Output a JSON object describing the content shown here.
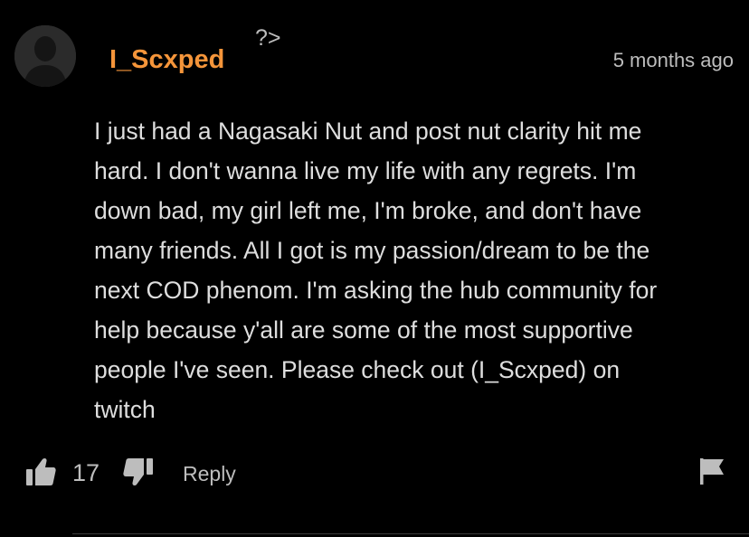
{
  "comment": {
    "username": "I_Scxped",
    "badge": "?>",
    "timestamp": "5 months ago",
    "text": "I just had a Nagasaki Nut and post nut clarity hit me\nhard. I don't wanna live my life with any regrets. I'm\ndown bad, my girl left me, I'm broke, and don't have\nmany friends. All I got is my passion/dream to be the\nnext COD phenom. I'm asking the hub community for\nhelp because y'all are some of the most supportive\npeople I've seen. Please check out (I_Scxped) on\ntwitch",
    "avatar_icon": "default-user-avatar",
    "colors": {
      "username": "#f5953a",
      "text": "#dedede",
      "muted": "#bdbdbd",
      "background": "#000000"
    }
  },
  "actions": {
    "like_icon": "thumbs-up-icon",
    "like_count": "17",
    "dislike_icon": "thumbs-down-icon",
    "reply_label": "Reply",
    "flag_icon": "flag-icon"
  }
}
